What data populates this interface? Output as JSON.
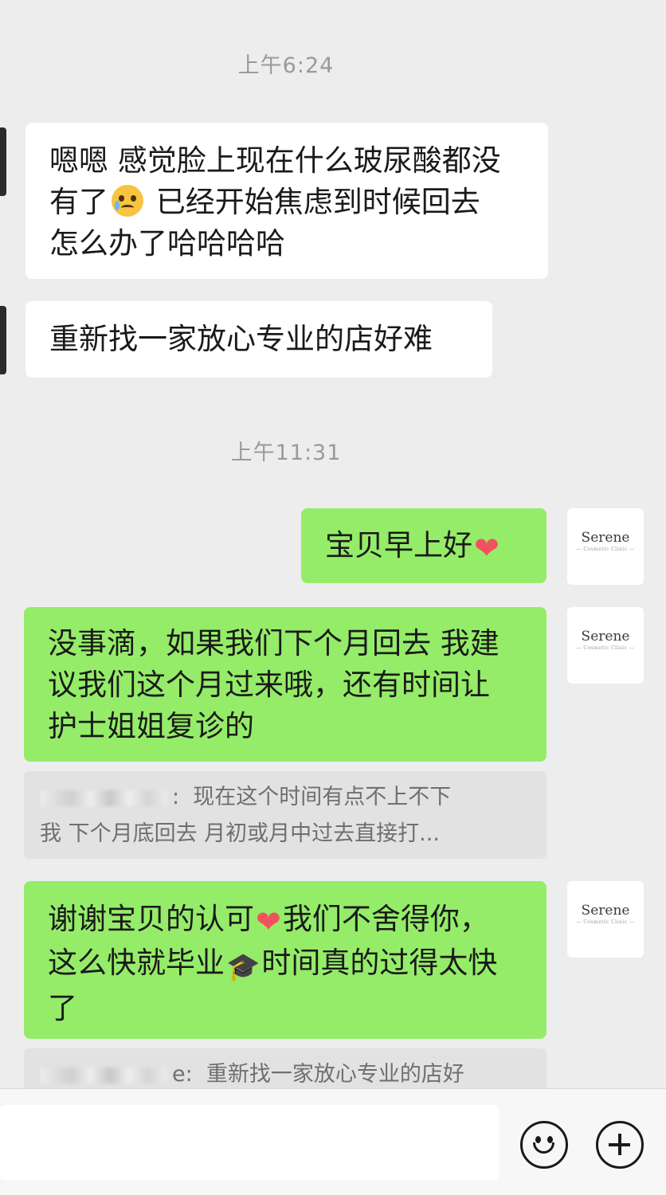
{
  "chat": {
    "timestamps": [
      "上午6:24",
      "上午11:31"
    ],
    "messages": [
      {
        "side": "in",
        "lines": [
          "嗯嗯 感觉脸上现在什么玻尿酸都没",
          "有了",
          " 已经开始焦虑到时候回去",
          "怎么办了哈哈哈哈"
        ]
      },
      {
        "side": "in",
        "lines": [
          "重新找一家放心专业的店好难"
        ]
      },
      {
        "side": "out",
        "lines": [
          "宝贝早上好"
        ]
      },
      {
        "side": "out",
        "lines": [
          "没事滴，如果我们下个月回去 我建",
          "议我们这个月过来哦，还有时间让",
          "护士姐姐复诊的"
        ]
      },
      {
        "side": "out",
        "lines": [
          "谢谢宝贝的认可",
          "我们不舍得你，",
          "这么快就毕业",
          "时间真的过得太快",
          "了"
        ]
      }
    ],
    "quotes": [
      {
        "sender_suffix": ":",
        "lines": [
          "现在这个时间有点不上不下",
          "我 下个月底回去 月初或月中过去直接打..."
        ]
      },
      {
        "sender_suffix": "e:",
        "lines": [
          "重新找一家放心专业的店好"
        ]
      }
    ],
    "self_avatar": {
      "brand": "Serene",
      "subtitle": "— Cosmetic Clinic —"
    }
  },
  "icons": {
    "crying_face": "crying-face-emoji",
    "heart": "heart-emoji",
    "graduation_cap": "graduation-cap-emoji",
    "emoji_button": "smiley-face-icon",
    "more_button": "plus-circle-icon"
  },
  "colors": {
    "background": "#ededed",
    "incoming_bubble": "#ffffff",
    "outgoing_bubble": "#95ec69",
    "quote_background": "#e2e2e2",
    "heart": "#f2525e"
  },
  "input": {
    "value": "",
    "placeholder": ""
  }
}
